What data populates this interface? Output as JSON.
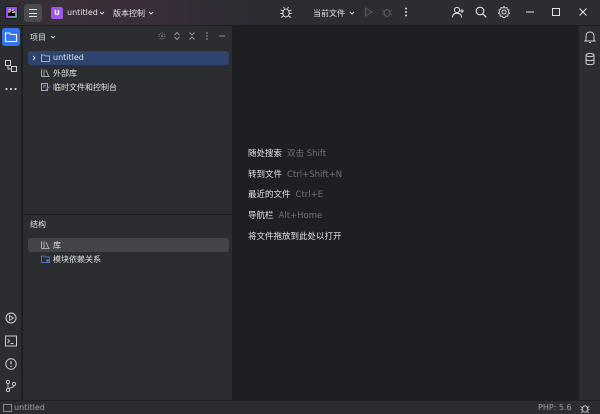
{
  "titlebar": {
    "project_badge": "U",
    "project_name": "untitled",
    "vcs_label": "版本控制",
    "run_config": "当前文件"
  },
  "project_panel": {
    "title": "项目",
    "tree": [
      {
        "label": "untitled",
        "icon": "folder-icon",
        "expanded": false
      },
      {
        "label": "外部库",
        "icon": "library-icon"
      },
      {
        "label": "临时文件和控制台",
        "icon": "scratches-icon"
      }
    ]
  },
  "structure_panel": {
    "title": "结构",
    "items": [
      {
        "label": "库",
        "icon": "library-icon"
      },
      {
        "label": "模块依赖关系",
        "icon": "module-dependency-icon"
      }
    ]
  },
  "editor_hints": [
    {
      "action": "随处搜索",
      "shortcut": "双击 Shift"
    },
    {
      "action": "转到文件",
      "shortcut": "Ctrl+Shift+N"
    },
    {
      "action": "最近的文件",
      "shortcut": "Ctrl+E"
    },
    {
      "action": "导航栏",
      "shortcut": "Alt+Home"
    },
    {
      "action": "将文件拖放到此处以打开",
      "shortcut": ""
    }
  ],
  "statusbar": {
    "breadcrumb": "untitled",
    "php_version": "PHP: 5.6"
  },
  "colors": {
    "accent": "#3574f0",
    "project_badge": "#a256e8",
    "selection": "#2e436e"
  }
}
